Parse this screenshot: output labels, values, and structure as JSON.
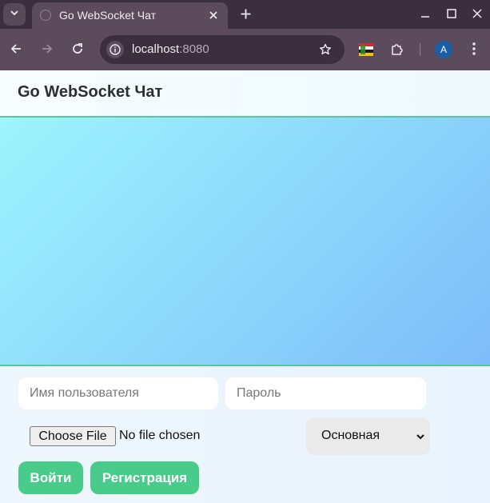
{
  "browser": {
    "tab_title": "Go WebSocket Чат",
    "url_host": "localhost",
    "url_port": ":8080",
    "avatar_letter": "A"
  },
  "icons": {
    "tab_menu": "chevron-down-icon",
    "favicon": "globe-icon",
    "tab_close": "close-icon",
    "new_tab": "plus-icon",
    "minimize": "minimize-icon",
    "maximize": "maximize-icon",
    "close_window": "close-icon",
    "back": "arrow-left-icon",
    "forward": "arrow-right-icon",
    "reload": "reload-icon",
    "site_info": "info-icon",
    "bookmark": "star-icon",
    "extension_flag": "flag-icon",
    "extensions": "puzzle-icon",
    "menu": "kebab-menu-icon"
  },
  "app": {
    "title": "Go WebSocket Чат",
    "username_placeholder": "Имя пользователя",
    "password_placeholder": "Пароль",
    "file_button": "Choose File",
    "file_status": "No file chosen",
    "room_selected": "Основная",
    "login_button": "Войти",
    "register_button": "Регистрация"
  },
  "colors": {
    "accent": "#49cc8a",
    "divider": "#5ec49b",
    "chat_gradient_start": "#9ef4fc",
    "chat_gradient_end": "#7ebcf9"
  }
}
